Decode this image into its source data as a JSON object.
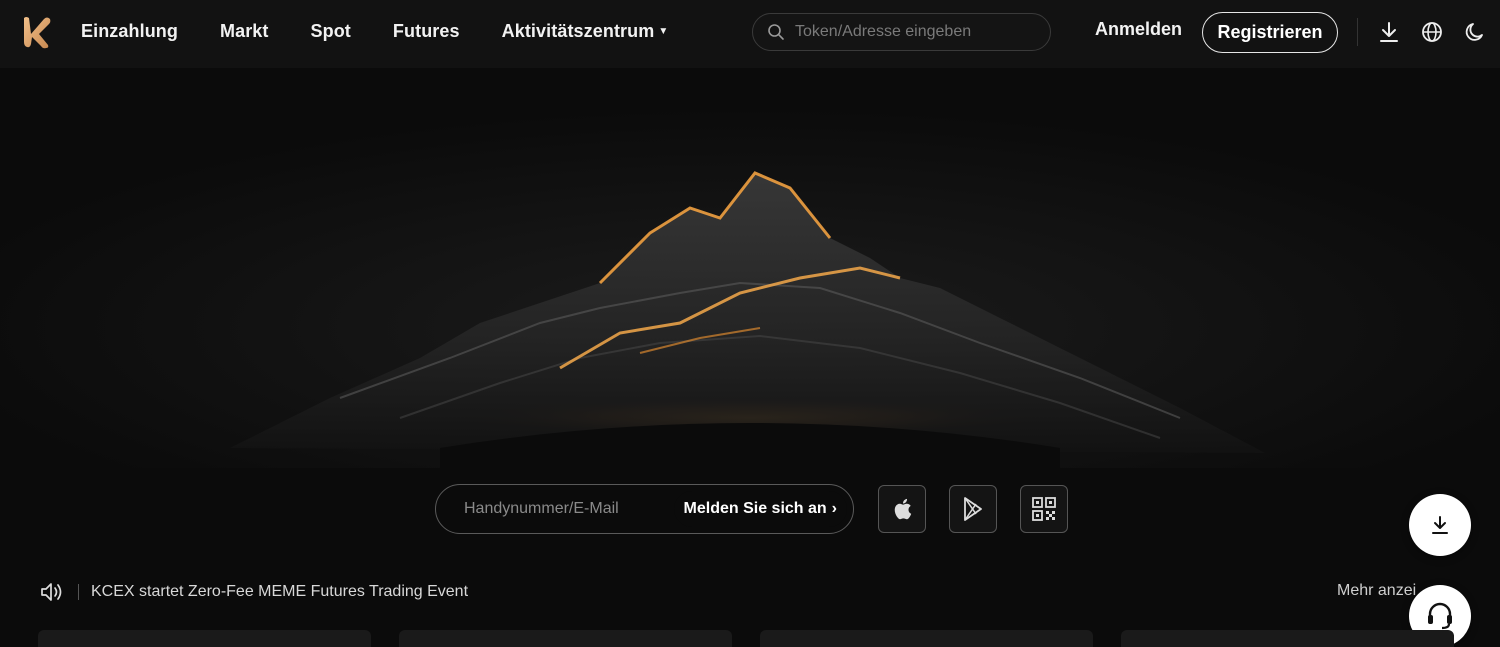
{
  "header": {
    "logo": {
      "icon": "kcex-logo-icon",
      "color": "#d9a26a"
    },
    "nav": [
      {
        "label": "Einzahlung"
      },
      {
        "label": "Markt"
      },
      {
        "label": "Spot"
      },
      {
        "label": "Futures"
      },
      {
        "label": "Aktivitätszentrum",
        "has_dropdown": true
      }
    ],
    "search": {
      "placeholder": "Token/Adresse eingeben",
      "value": ""
    },
    "login_label": "Anmelden",
    "register_label": "Registrieren",
    "icons": [
      "download-icon",
      "globe-icon",
      "moon-icon"
    ]
  },
  "hero": {
    "image": "mountain-illustration",
    "accent_color": "#f0a040"
  },
  "signup": {
    "placeholder": "Handynummer/E-Mail",
    "button_label": "Melden Sie sich an",
    "app_icons": [
      "apple-icon",
      "google-play-icon",
      "qr-code-icon"
    ]
  },
  "announcement": {
    "icon": "speaker-icon",
    "text": "KCEX startet Zero-Fee MEME Futures Trading Event",
    "more_label": "Mehr anzei"
  },
  "floating": {
    "icons": [
      "download-icon",
      "headset-icon"
    ]
  }
}
